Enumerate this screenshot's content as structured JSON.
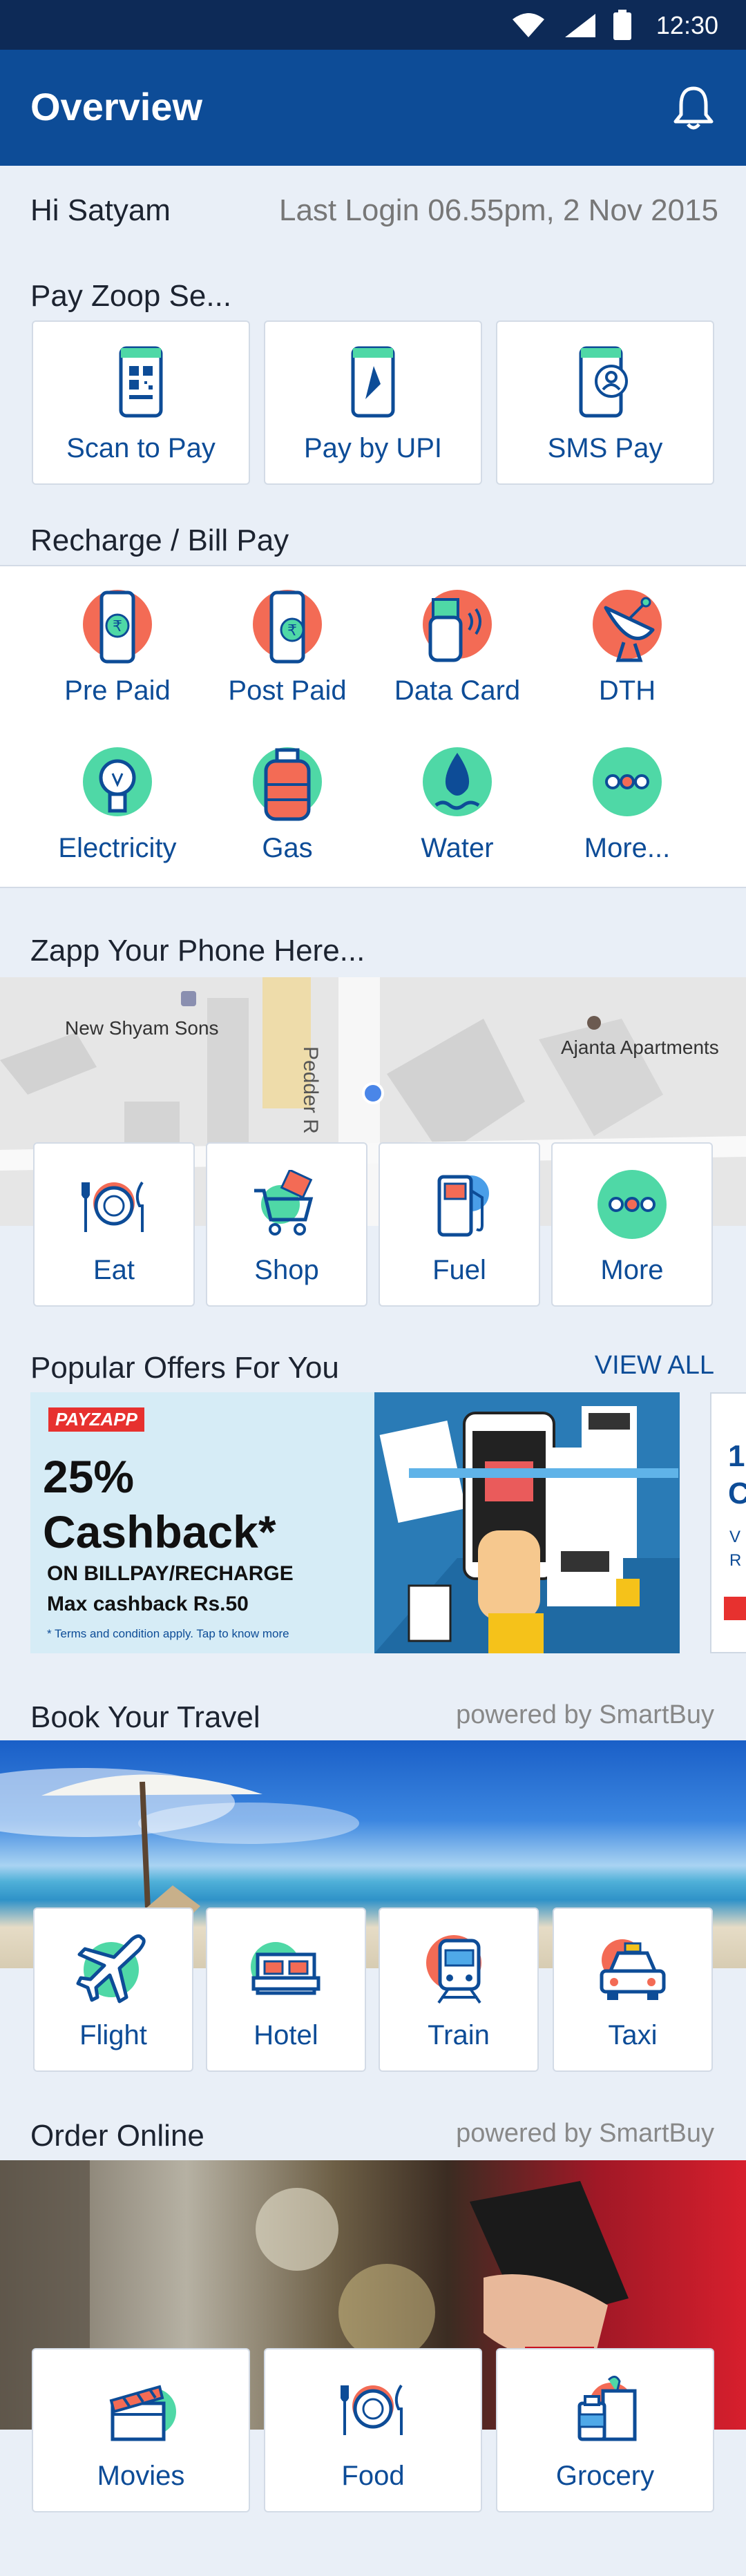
{
  "status_bar": {
    "time": "12:30"
  },
  "header": {
    "title": "Overview"
  },
  "greeting": {
    "name": "Hi Satyam",
    "last_login": "Last Login 06.55pm, 2 Nov 2015"
  },
  "pay_section": {
    "title": "Pay Zoop Se...",
    "items": [
      {
        "label": "Scan to Pay",
        "icon": "qr-phone-icon"
      },
      {
        "label": "Pay by UPI",
        "icon": "upi-phone-icon"
      },
      {
        "label": "SMS Pay",
        "icon": "sms-phone-icon"
      }
    ]
  },
  "recharge_section": {
    "title": "Recharge / Bill Pay",
    "items": [
      {
        "label": "Pre Paid",
        "icon": "prepaid-phone-icon"
      },
      {
        "label": "Post Paid",
        "icon": "postpaid-phone-icon"
      },
      {
        "label": "Data Card",
        "icon": "data-card-icon"
      },
      {
        "label": "DTH",
        "icon": "satellite-dish-icon"
      },
      {
        "label": "Electricity",
        "icon": "bulb-icon"
      },
      {
        "label": "Gas",
        "icon": "gas-cylinder-icon"
      },
      {
        "label": "Water",
        "icon": "water-drop-icon"
      },
      {
        "label": "More...",
        "icon": "more-dots-icon"
      }
    ]
  },
  "zapp_section": {
    "title": "Zapp Your Phone Here...",
    "map_labels": [
      "New Shyam Sons",
      "Pedder R",
      "Ajanta Apartments"
    ],
    "items": [
      {
        "label": "Eat",
        "icon": "plate-cutlery-icon"
      },
      {
        "label": "Shop",
        "icon": "shopping-cart-icon"
      },
      {
        "label": "Fuel",
        "icon": "fuel-pump-icon"
      },
      {
        "label": "More",
        "icon": "more-dots-icon"
      }
    ]
  },
  "offers_section": {
    "title": "Popular Offers For You",
    "view_all": "VIEW ALL",
    "banner": {
      "brand": "PAYZAPP",
      "percent": "25%",
      "headline": "Cashback*",
      "line1": "ON BILLPAY/RECHARGE",
      "line2": "Max cashback Rs.50",
      "terms": "* Terms and condition apply. Tap to know more"
    },
    "next_banner_fragments": [
      "1",
      "C",
      "V",
      "R"
    ]
  },
  "travel_section": {
    "title": "Book Your Travel",
    "powered": "powered by SmartBuy",
    "items": [
      {
        "label": "Flight",
        "icon": "airplane-icon"
      },
      {
        "label": "Hotel",
        "icon": "hotel-bed-icon"
      },
      {
        "label": "Train",
        "icon": "train-icon"
      },
      {
        "label": "Taxi",
        "icon": "taxi-icon"
      }
    ]
  },
  "order_section": {
    "title": "Order Online",
    "powered": "powered by SmartBuy",
    "items": [
      {
        "label": "Movies",
        "icon": "clapperboard-icon"
      },
      {
        "label": "Food",
        "icon": "plate-cutlery-icon"
      },
      {
        "label": "Grocery",
        "icon": "grocery-bag-icon"
      }
    ]
  },
  "colors": {
    "primary": "#0d4c97",
    "status_bar": "#0d2a57",
    "accent_red": "#f36b55",
    "accent_green": "#4fd8a6"
  }
}
